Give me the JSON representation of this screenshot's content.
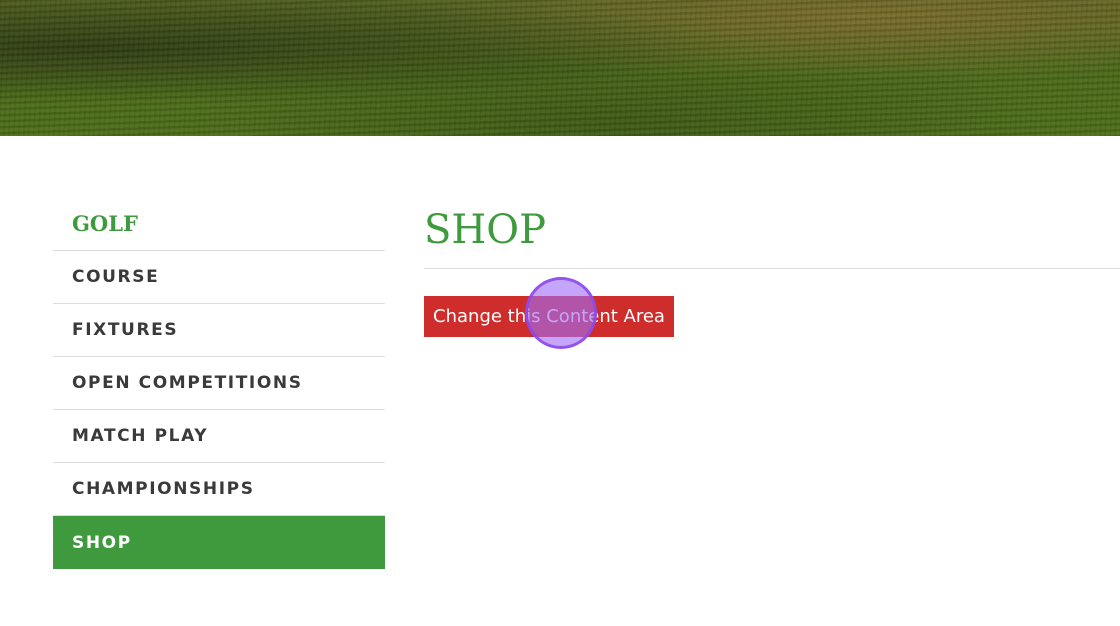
{
  "hero": {
    "image": "golf-course-grass"
  },
  "sidebar": {
    "heading": "GOLF",
    "items": [
      {
        "label": "COURSE"
      },
      {
        "label": "FIXTURES"
      },
      {
        "label": "OPEN COMPETITIONS"
      },
      {
        "label": "MATCH PLAY"
      },
      {
        "label": "CHAMPIONSHIPS"
      },
      {
        "label": "SHOP",
        "active": true
      }
    ]
  },
  "main": {
    "title": "SHOP",
    "edit_button_label": "Change this Content Area"
  },
  "colors": {
    "accent_green": "#3e9a3c",
    "button_red": "#cf2c2c"
  }
}
